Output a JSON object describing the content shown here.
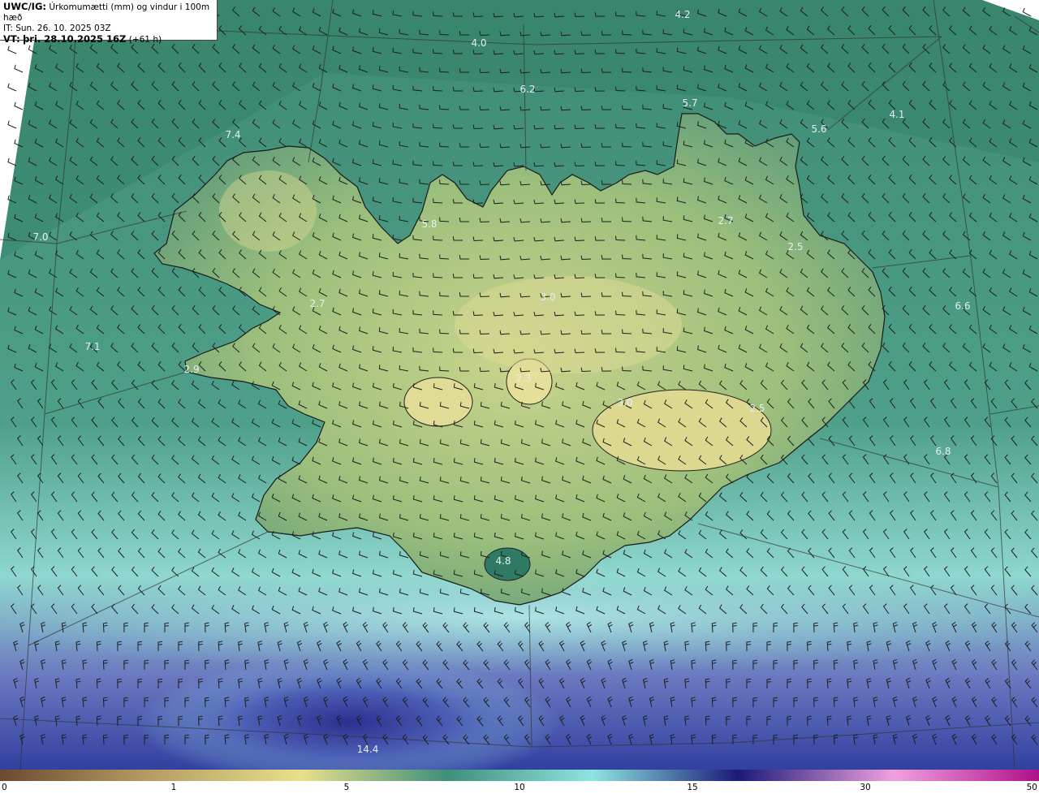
{
  "header": {
    "product": "UWC/IG:",
    "description": "Úrkomumætti (mm) og vindur i 100m hæð",
    "issue_time": "IT: Sun. 26. 10. 2025 03Z",
    "valid_label": "VT:",
    "valid_time": "þri. 28.10.2025 16Z",
    "lead": "(+61 h)"
  },
  "map_values": [
    "4.2",
    "4.0",
    "6.2",
    "5.7",
    "5.6",
    "4.1",
    "7.4",
    "5.8",
    "2.7",
    "2.5",
    "7.0",
    "2.7",
    "6.6",
    "7.1",
    "2.9",
    "3.0",
    "2.3",
    "3.0",
    "2.5",
    "6.8",
    "4.8",
    "14.4"
  ],
  "colorbar": {
    "ticks": [
      "0",
      "1",
      "5",
      "10",
      "15",
      "30",
      "50"
    ],
    "colors": [
      "#6b4a2e",
      "#b59a62",
      "#e8e08a",
      "#3e8f7a",
      "#8ee5e0",
      "#1a1a7a",
      "#f0a0e0",
      "#b0108a"
    ]
  }
}
